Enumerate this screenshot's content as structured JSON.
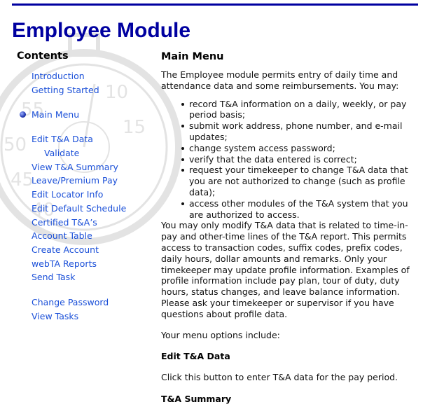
{
  "header": {
    "title": "Employee Module",
    "accent_color": "#0000a0"
  },
  "sidebar": {
    "title": "Contents",
    "link_color": "#1a4fd8",
    "current_marker_icon": "blue-sphere-bullet",
    "items": [
      {
        "label": "Introduction"
      },
      {
        "label": "Getting Started"
      },
      {
        "label": "Main Menu",
        "current": true
      },
      {
        "label": "Edit T&A Data"
      },
      {
        "label": "Validate",
        "indent": true
      },
      {
        "label": "View T&A Summary"
      },
      {
        "label": "Leave/Premium Pay"
      },
      {
        "label": "Edit Locator Info"
      },
      {
        "label": "Edit Default Schedule"
      },
      {
        "label": "Certified T&A’s"
      },
      {
        "label": "Account Table"
      },
      {
        "label": "Create Account"
      },
      {
        "label": "webTA Reports"
      },
      {
        "label": "Send Task"
      },
      {
        "label": "Change Password"
      },
      {
        "label": "View Tasks"
      }
    ]
  },
  "main": {
    "heading": "Main Menu",
    "intro": "The Employee module permits entry of daily time and attendance data and some reimbursements. You may:",
    "bullets": [
      "record T&A information on a daily, weekly, or pay period basis;",
      "submit work address, phone number, and e-mail updates;",
      "change system access password;",
      "verify that the data entered is correct;",
      "request your timekeeper to change T&A data that you are not authorized to change (such as profile data);",
      "access other modules of the T&A system that you are authorized to access."
    ],
    "body": "You may only modify T&A data that is related to time-in-pay and other-time lines of the T&A report. This permits access to transaction codes, suffix codes, prefix codes, daily hours, dollar amounts and remarks. Only your timekeeper may update profile information. Examples of profile information include pay plan, tour of duty, duty hours, status changes, and leave balance information. Please ask your timekeeper or supervisor if you have questions about profile data.",
    "options_intro": "Your menu options include:",
    "sections": [
      {
        "title": "Edit T&A Data",
        "text": "Click this button to enter T&A data for the pay period."
      },
      {
        "title": "T&A Summary"
      }
    ]
  }
}
